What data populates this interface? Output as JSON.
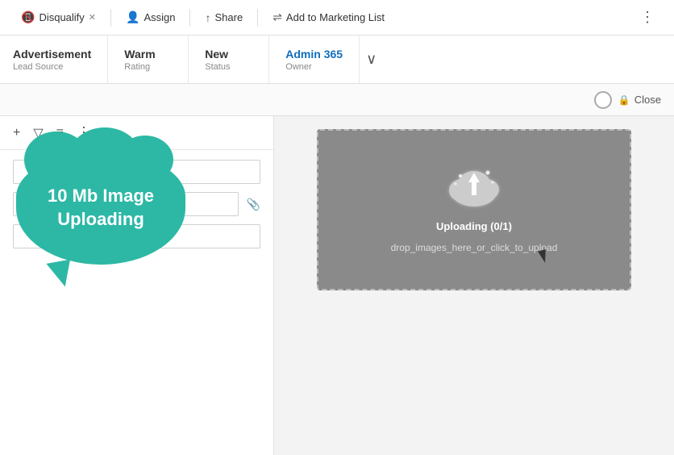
{
  "toolbar": {
    "disqualify_label": "Disqualify",
    "assign_label": "Assign",
    "share_label": "Share",
    "add_to_marketing_label": "Add to Marketing List",
    "more_icon": "⋮"
  },
  "info_bar": {
    "fields": [
      {
        "value": "Advertisement",
        "label": "Lead Source"
      },
      {
        "value": "Warm",
        "label": "Rating"
      },
      {
        "value": "New",
        "label": "Status"
      },
      {
        "value": "Admin 365",
        "label": "Owner",
        "blue": true
      }
    ],
    "chevron": "∨"
  },
  "status_bar": {
    "close_label": "Close",
    "lock_icon": "🔒"
  },
  "cloud_tooltip": {
    "line1": "10 Mb Image",
    "line2": "Uploading"
  },
  "left_panel": {
    "tools": {
      "plus": "+",
      "filter": "▽",
      "list": "≡",
      "dots": "⋮"
    }
  },
  "upload_area": {
    "uploading_label": "Uploading (0/1)",
    "drop_label": "drop_images_here_or_click_to_upload"
  }
}
